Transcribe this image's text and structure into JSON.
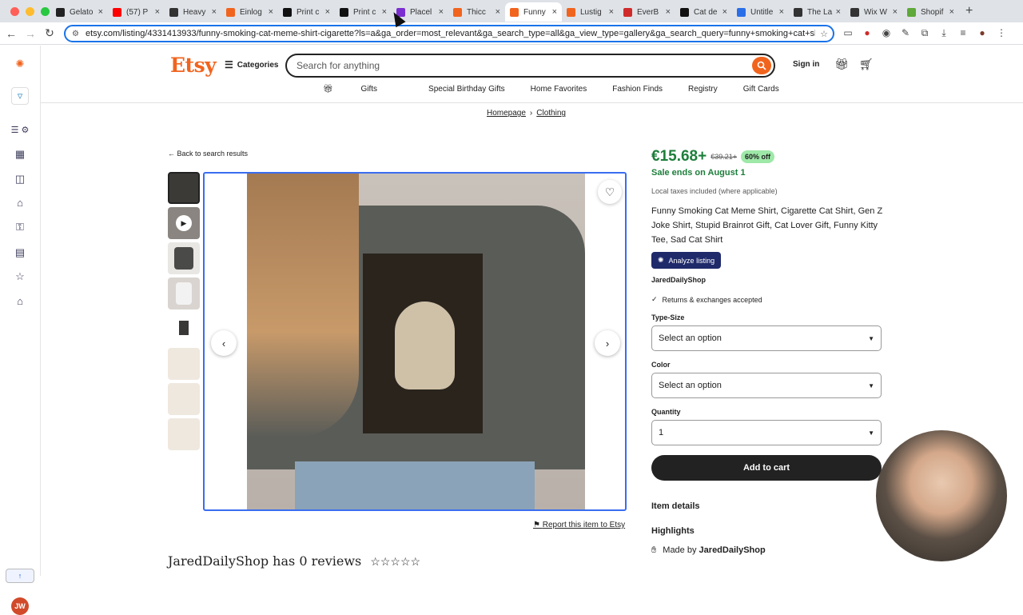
{
  "browser": {
    "tabs": [
      {
        "title": "Gelato",
        "favicon_color": "#222222"
      },
      {
        "title": "(57) P",
        "favicon_color": "#ff0000"
      },
      {
        "title": "Heavy",
        "favicon_color": "#333333"
      },
      {
        "title": "Einlog",
        "favicon_color": "#f1641e"
      },
      {
        "title": "Print c",
        "favicon_color": "#111111"
      },
      {
        "title": "Print c",
        "favicon_color": "#111111"
      },
      {
        "title": "Placel",
        "favicon_color": "#7b2fd1"
      },
      {
        "title": "Thicc",
        "favicon_color": "#f1641e"
      },
      {
        "title": "Funny",
        "favicon_color": "#f1641e",
        "active": true
      },
      {
        "title": "Lustig",
        "favicon_color": "#f1641e"
      },
      {
        "title": "EverB",
        "favicon_color": "#d02b2b"
      },
      {
        "title": "Cat de",
        "favicon_color": "#111111"
      },
      {
        "title": "Untitle",
        "favicon_color": "#2b6fe8"
      },
      {
        "title": "The La",
        "favicon_color": "#333333"
      },
      {
        "title": "Wix W",
        "favicon_color": "#333333"
      },
      {
        "title": "Shopif",
        "favicon_color": "#5fa83a"
      }
    ],
    "url": "etsy.com/listing/4331413933/funny-smoking-cat-meme-shirt-cigarette?ls=a&ga_order=most_relevant&ga_search_type=all&ga_view_type=gallery&ga_search_query=funny+smoking+cat+shirt&ref=sc_ga..."
  },
  "header": {
    "logo": "Etsy",
    "categories": "Categories",
    "search_placeholder": "Search for anything",
    "sign_in": "Sign in",
    "nav": [
      "Gifts",
      "Special Birthday Gifts",
      "Home Favorites",
      "Fashion Finds",
      "Registry",
      "Gift Cards"
    ]
  },
  "breadcrumb": {
    "home": "Homepage",
    "category": "Clothing"
  },
  "back_link": "Back to search results",
  "listing": {
    "price": "€15.68+",
    "old_price": "€39.21+",
    "discount": "60% off",
    "sale_ends": "Sale ends on August 1",
    "tax_note": "Local taxes included (where applicable)",
    "title": "Funny Smoking Cat Meme Shirt, Cigarette Cat Shirt, Gen Z Joke Shirt, Stupid Brainrot Gift, Cat Lover Gift, Funny Kitty Tee, Sad Cat Shirt",
    "analyze": "Analyze listing",
    "shop": "JaredDailyShop",
    "returns": "Returns & exchanges accepted",
    "type_size_label": "Type-Size",
    "type_size_value": "Select an option",
    "color_label": "Color",
    "color_value": "Select an option",
    "quantity_label": "Quantity",
    "quantity_value": "1",
    "add_to_cart": "Add to cart",
    "item_details": "Item details",
    "highlights": "Highlights",
    "made_by_prefix": "Made by",
    "made_by_shop": "JaredDailyShop",
    "report": "Report this item to Etsy",
    "reviews_heading": "JaredDailyShop has 0 reviews",
    "stars": "☆☆☆☆☆"
  },
  "sidebar": {
    "avatar_initials": "JW"
  },
  "colors": {
    "accent": "#f1641e",
    "sale_green": "#1d7e3b",
    "focus_blue": "#3a6df0"
  }
}
